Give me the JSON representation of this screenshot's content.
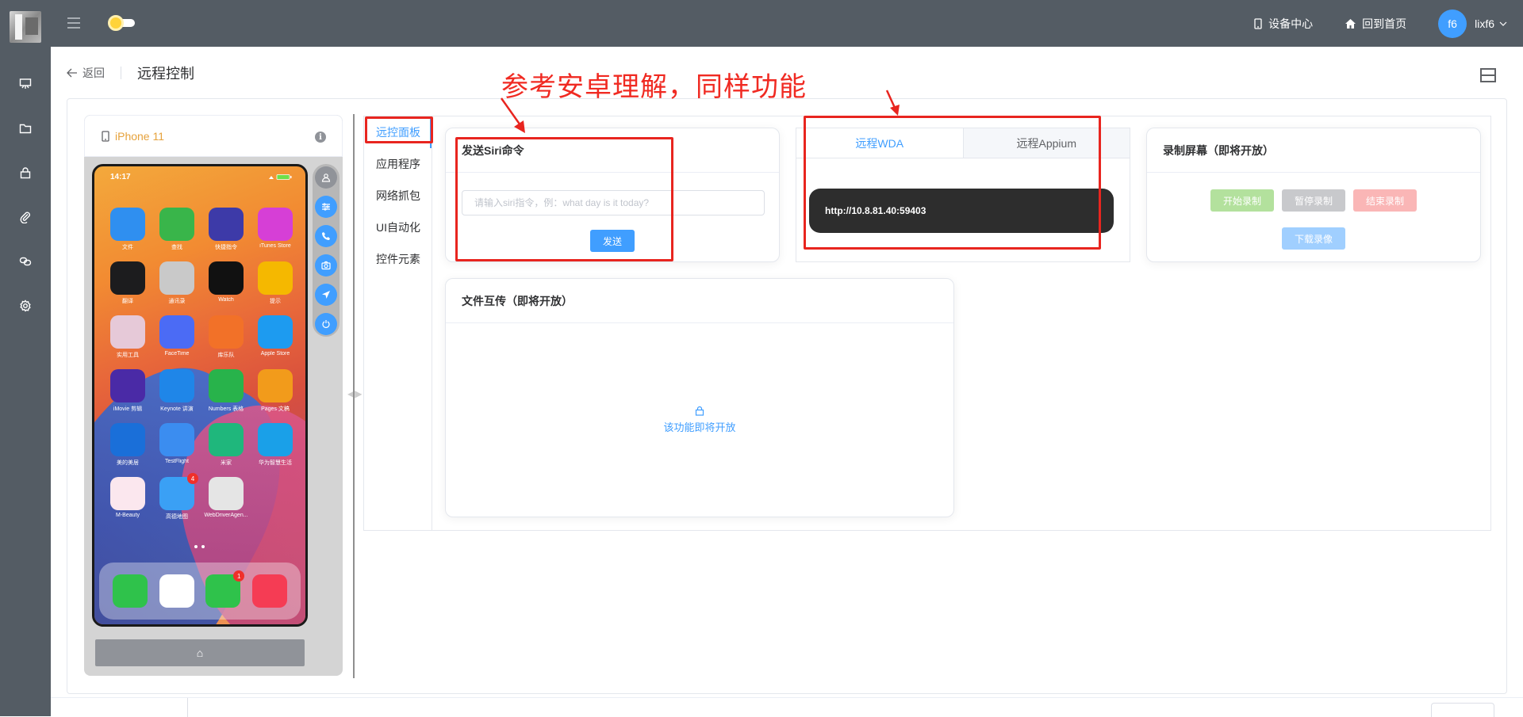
{
  "header": {
    "nav_links": [
      {
        "label": "设备中心",
        "icon": "mobile-icon"
      },
      {
        "label": "回到首页",
        "icon": "home-icon"
      }
    ],
    "user": {
      "avatar_text": "f6",
      "name": "lixf6"
    }
  },
  "sidebar": {
    "items": [
      {
        "icon": "presentation-icon"
      },
      {
        "icon": "folder-icon"
      },
      {
        "icon": "lock-icon"
      },
      {
        "icon": "paperclip-icon"
      },
      {
        "icon": "link-icon"
      },
      {
        "icon": "gear-icon"
      }
    ]
  },
  "breadcrumb": {
    "back_label": "返回",
    "page_title": "远程控制"
  },
  "annotation": {
    "text": "参考安卓理解，同样功能"
  },
  "device": {
    "name": "iPhone 11",
    "info_icon_text": "i",
    "status_time": "14:17",
    "home_button_label": "⌂",
    "apps": [
      {
        "label": "文件",
        "color": "#2f8ff0"
      },
      {
        "label": "查找",
        "color": "#39b54a"
      },
      {
        "label": "快捷指令",
        "color": "#3d3aa8"
      },
      {
        "label": "iTunes Store",
        "color": "#d63fd6"
      },
      {
        "label": "翻译",
        "color": "#1c1c1e"
      },
      {
        "label": "通讯录",
        "color": "#c9c9c9"
      },
      {
        "label": "Watch",
        "color": "#111111"
      },
      {
        "label": "提示",
        "color": "#f5b800"
      },
      {
        "label": "实用工具",
        "color": "#e6c9d8"
      },
      {
        "label": "FaceTime",
        "color": "#4b6bf5"
      },
      {
        "label": "库乐队",
        "color": "#f27128"
      },
      {
        "label": "Apple Store",
        "color": "#1d9bf0"
      },
      {
        "label": "iMovie 剪辑",
        "color": "#4a2aa6"
      },
      {
        "label": "Keynote 讲演",
        "color": "#1f86e8"
      },
      {
        "label": "Numbers 表格",
        "color": "#28b34b"
      },
      {
        "label": "Pages 文稿",
        "color": "#f29b1b"
      },
      {
        "label": "美的美居",
        "color": "#1a6fd9"
      },
      {
        "label": "TestFlight",
        "color": "#3b8df0"
      },
      {
        "label": "米家",
        "color": "#1fb77c"
      },
      {
        "label": "华为智慧生活",
        "color": "#1aa0e8"
      },
      {
        "label": "M-Beauty",
        "color": "#fbe7ee"
      },
      {
        "label": "高德地图",
        "color": "#3aa0f5",
        "badge": "4"
      },
      {
        "label": "WebDriverAgen...",
        "color": "#e5e5e5"
      }
    ],
    "dock": [
      {
        "name": "phone-app-icon",
        "color": "#2fc24b"
      },
      {
        "name": "safari-app-icon",
        "color": "#ffffff"
      },
      {
        "name": "messages-app-icon",
        "color": "#2fc24b",
        "badge": "1"
      },
      {
        "name": "music-app-icon",
        "color": "#f53c54"
      }
    ],
    "side_buttons": [
      "user-icon",
      "sliders-icon",
      "phone-call-icon",
      "camera-icon",
      "location-icon",
      "power-icon"
    ]
  },
  "tabs": {
    "items": [
      "远控面板",
      "应用程序",
      "网络抓包",
      "UI自动化",
      "控件元素"
    ],
    "active_index": 0
  },
  "siri": {
    "title": "发送Siri命令",
    "placeholder": "请输入siri指令，例：what day is it today?",
    "send_label": "发送"
  },
  "wda": {
    "tabs": [
      "远程WDA",
      "远程Appium"
    ],
    "url": "http://10.8.81.40:59403"
  },
  "record": {
    "title": "录制屏幕（即将开放）",
    "start_label": "开始录制",
    "pause_label": "暂停录制",
    "stop_label": "结束录制",
    "download_label": "下载录像"
  },
  "file": {
    "title": "文件互传（即将开放）",
    "coming_soon": "该功能即将开放"
  },
  "colors": {
    "primary": "#409eff",
    "header_bg": "#545c64",
    "annotation_red": "#e8251f",
    "success_light": "#b3e19d",
    "info_light": "#c8c9cc",
    "danger_light": "#fab6b6",
    "primary_light": "#a0cfff"
  }
}
